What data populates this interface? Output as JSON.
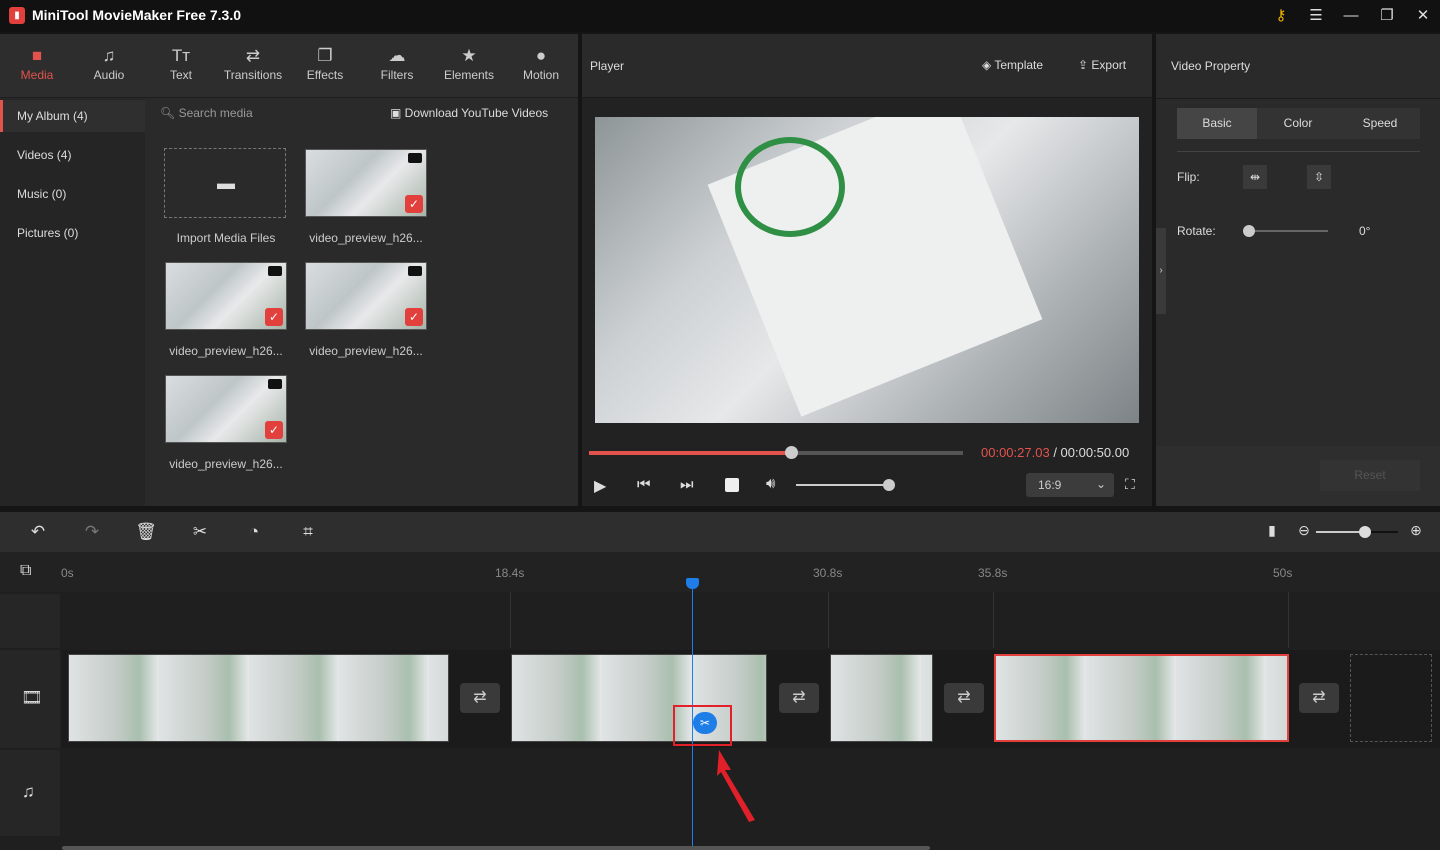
{
  "app": {
    "title": "MiniTool MovieMaker Free 7.3.0"
  },
  "toolbar": [
    {
      "label": "Media",
      "icon": "folder-icon"
    },
    {
      "label": "Audio",
      "icon": "music-icon"
    },
    {
      "label": "Text",
      "icon": "text-icon"
    },
    {
      "label": "Transitions",
      "icon": "transitions-icon"
    },
    {
      "label": "Effects",
      "icon": "effects-icon"
    },
    {
      "label": "Filters",
      "icon": "filters-icon"
    },
    {
      "label": "Elements",
      "icon": "elements-icon"
    },
    {
      "label": "Motion",
      "icon": "motion-icon"
    }
  ],
  "sidebar": [
    {
      "label": "My Album (4)"
    },
    {
      "label": "Videos (4)"
    },
    {
      "label": "Music (0)"
    },
    {
      "label": "Pictures (0)"
    }
  ],
  "media": {
    "search_placeholder": "Search media",
    "download": "Download YouTube Videos",
    "import": "Import Media Files",
    "items": [
      "video_preview_h26...",
      "video_preview_h26...",
      "video_preview_h26...",
      "video_preview_h26..."
    ]
  },
  "player": {
    "title": "Player",
    "template": "Template",
    "export": "Export",
    "current": "00:00:27.03",
    "total": "/ 00:00:50.00",
    "progress": 0.54,
    "volume": 1.0,
    "aspect": "16:9",
    "accent": "#e2534d"
  },
  "props": {
    "title": "Video Property",
    "tabs": [
      "Basic",
      "Color",
      "Speed"
    ],
    "flip": "Flip:",
    "rotate": "Rotate:",
    "rotate_value": "0°",
    "reset": "Reset"
  },
  "timeline": {
    "ticks": [
      "0s",
      "18.4s",
      "30.8s",
      "35.8s",
      "50s"
    ],
    "playhead": "#1e7de6",
    "zoom": 0.6
  }
}
